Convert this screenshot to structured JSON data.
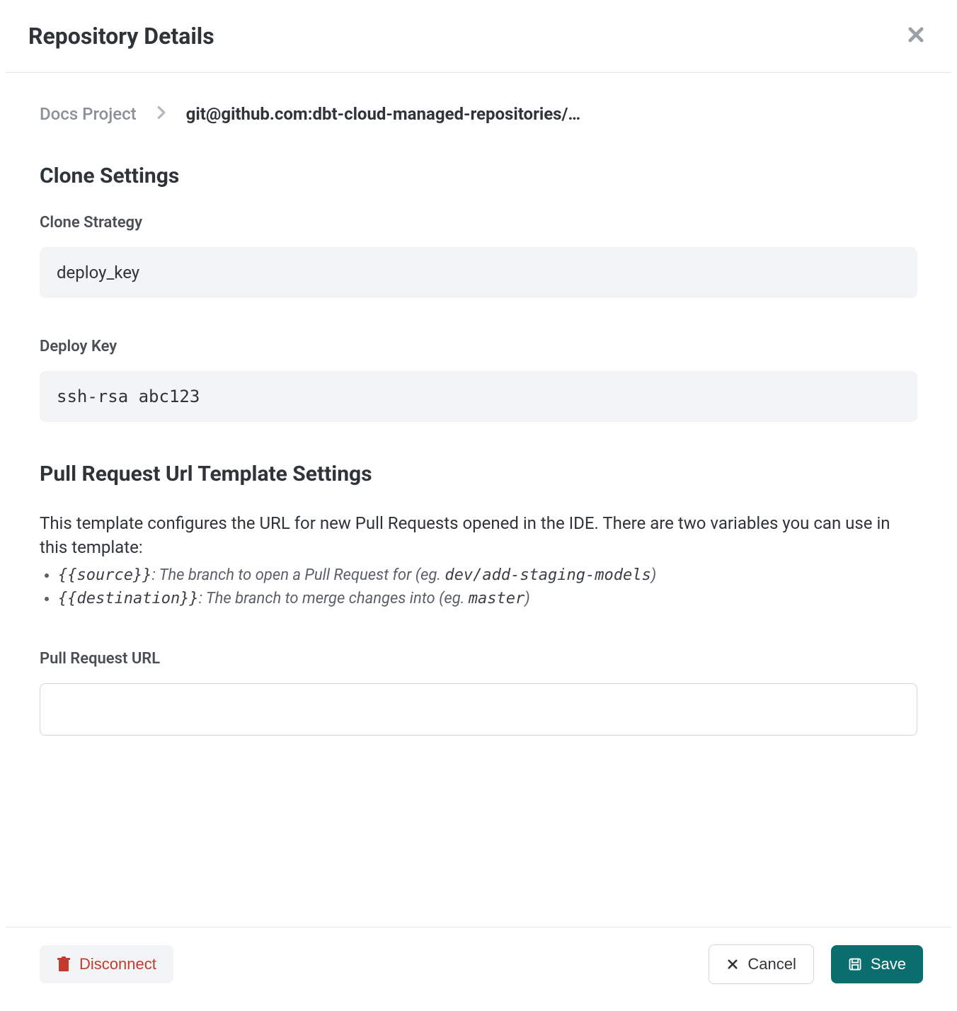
{
  "header": {
    "title": "Repository Details"
  },
  "breadcrumb": {
    "project": "Docs Project",
    "current": "git@github.com:dbt-cloud-managed-repositories/…"
  },
  "clone_settings": {
    "section_title": "Clone Settings",
    "strategy_label": "Clone Strategy",
    "strategy_value": "deploy_key",
    "deploy_key_label": "Deploy Key",
    "deploy_key_value": "ssh-rsa abc123"
  },
  "pr_settings": {
    "section_title": "Pull Request Url Template Settings",
    "description": "This template configures the URL for new Pull Requests opened in the IDE. There are two variables you can use in this template:",
    "var1_code": "{{source}}",
    "var1_desc_prefix": ": The branch to open a Pull Request for (eg. ",
    "var1_example": "dev/add-staging-models",
    "var1_desc_suffix": ")",
    "var2_code": "{{destination}}",
    "var2_desc_prefix": ": The branch to merge changes into (eg. ",
    "var2_example": "master",
    "var2_desc_suffix": ")",
    "url_label": "Pull Request URL",
    "url_value": ""
  },
  "footer": {
    "disconnect": "Disconnect",
    "cancel": "Cancel",
    "save": "Save"
  }
}
